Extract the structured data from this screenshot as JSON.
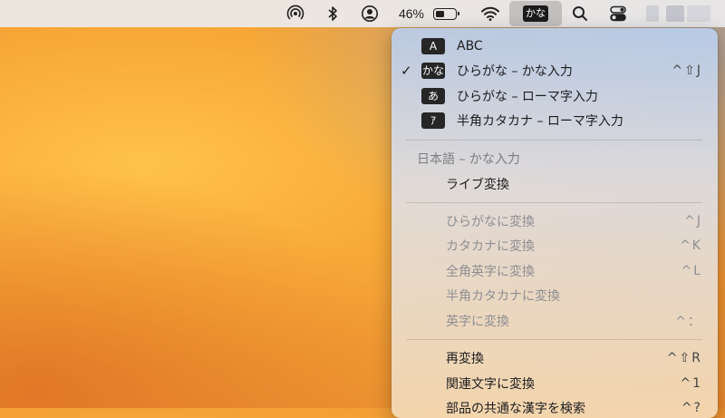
{
  "menubar": {
    "battery_percent": "46%",
    "battery_level": 0.46,
    "input_badge": "かな",
    "icons": [
      "airdrop-icon",
      "bluetooth-icon",
      "user-icon",
      "battery-icon",
      "wifi-icon",
      "input-method-icon",
      "search-icon",
      "control-center-icon"
    ]
  },
  "menu": {
    "input_sources": [
      {
        "badge": "A",
        "label": "ABC",
        "shortcut": "",
        "checked": false
      },
      {
        "badge": "かな",
        "label": "ひらがな – かな入力",
        "shortcut": "^⇧J",
        "checked": true
      },
      {
        "badge": "あ",
        "label": "ひらがな – ローマ字入力",
        "shortcut": "",
        "checked": false
      },
      {
        "badge": "ｱ",
        "label": "半角カタカナ – ローマ字入力",
        "shortcut": "",
        "checked": false
      }
    ],
    "section_header": "日本語 – かな入力",
    "live_conversion": "ライブ変換",
    "conversions": [
      {
        "label": "ひらがなに変換",
        "shortcut": "^J"
      },
      {
        "label": "カタカナに変換",
        "shortcut": "^K"
      },
      {
        "label": "全角英字に変換",
        "shortcut": "^L"
      },
      {
        "label": "半角カタカナに変換",
        "shortcut": ""
      },
      {
        "label": "英字に変換",
        "shortcut": "^："
      }
    ],
    "actions": [
      {
        "label": "再変換",
        "shortcut": "^⇧R"
      },
      {
        "label": "関連文字に変換",
        "shortcut": "^1"
      },
      {
        "label": "部品の共通な漢字を検索",
        "shortcut": "^?"
      }
    ]
  },
  "colors": {
    "menubar_bg": "#ececee",
    "badge_bg": "#262626",
    "disabled_text": "#8e8e93"
  }
}
